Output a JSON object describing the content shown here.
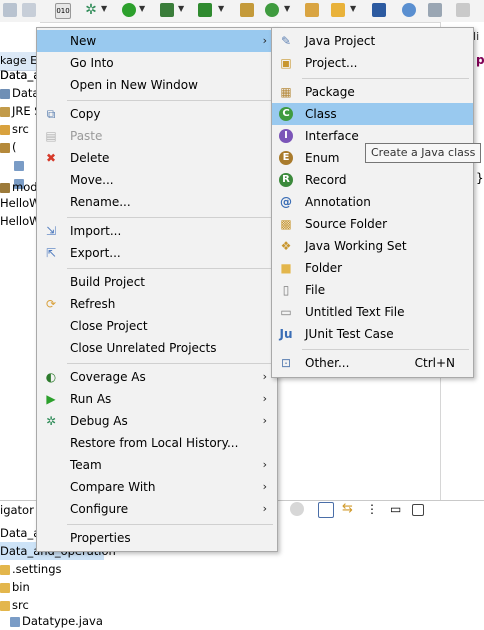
{
  "explorer": {
    "tab_title": "kage E:",
    "rows": [
      "Data_an",
      "Data_an",
      "JRE S",
      "src",
      "(",
      "",
      "",
      "mod",
      "HelloW",
      "HelloW"
    ]
  },
  "main_menu": {
    "items": [
      {
        "label": "New",
        "has_submenu": true,
        "icon": "none"
      },
      {
        "label": "Go Into",
        "has_submenu": false,
        "icon": "none"
      },
      {
        "label": "Open in New Window",
        "has_submenu": false,
        "icon": "none"
      },
      {
        "label": "Copy",
        "has_submenu": false,
        "icon": "copy-icon"
      },
      {
        "label": "Paste",
        "has_submenu": false,
        "icon": "paste-icon",
        "disabled": true
      },
      {
        "label": "Delete",
        "has_submenu": false,
        "icon": "delete-icon"
      },
      {
        "label": "Move...",
        "has_submenu": false,
        "icon": "none"
      },
      {
        "label": "Rename...",
        "has_submenu": false,
        "icon": "none"
      },
      {
        "label": "Import...",
        "has_submenu": false,
        "icon": "import-icon"
      },
      {
        "label": "Export...",
        "has_submenu": false,
        "icon": "export-icon"
      },
      {
        "label": "Build Project",
        "has_submenu": false,
        "icon": "none"
      },
      {
        "label": "Refresh",
        "has_submenu": false,
        "icon": "refresh-icon"
      },
      {
        "label": "Close Project",
        "has_submenu": false,
        "icon": "none"
      },
      {
        "label": "Close Unrelated Projects",
        "has_submenu": false,
        "icon": "none"
      },
      {
        "label": "Coverage As",
        "has_submenu": true,
        "icon": "coverage-icon"
      },
      {
        "label": "Run As",
        "has_submenu": true,
        "icon": "run-icon"
      },
      {
        "label": "Debug As",
        "has_submenu": true,
        "icon": "debug-icon"
      },
      {
        "label": "Restore from Local History...",
        "has_submenu": false,
        "icon": "none"
      },
      {
        "label": "Team",
        "has_submenu": true,
        "icon": "none"
      },
      {
        "label": "Compare With",
        "has_submenu": true,
        "icon": "none"
      },
      {
        "label": "Configure",
        "has_submenu": true,
        "icon": "none"
      },
      {
        "label": "Properties",
        "has_submenu": false,
        "icon": "none"
      }
    ]
  },
  "sub_menu": {
    "items": [
      {
        "label": "Java Project",
        "icon": "java-project-icon"
      },
      {
        "label": "Project...",
        "icon": "project-icon"
      },
      {
        "label": "Package",
        "icon": "package-icon"
      },
      {
        "label": "Class",
        "icon": "class-icon",
        "highlighted": true
      },
      {
        "label": "Interface",
        "icon": "interface-icon"
      },
      {
        "label": "Enum",
        "icon": "enum-icon"
      },
      {
        "label": "Record",
        "icon": "record-icon"
      },
      {
        "label": "Annotation",
        "icon": "annotation-icon"
      },
      {
        "label": "Source Folder",
        "icon": "source-folder-icon"
      },
      {
        "label": "Java Working Set",
        "icon": "working-set-icon"
      },
      {
        "label": "Folder",
        "icon": "folder-icon"
      },
      {
        "label": "File",
        "icon": "file-icon"
      },
      {
        "label": "Untitled Text File",
        "icon": "text-file-icon"
      },
      {
        "label": "JUnit Test Case",
        "icon": "junit-icon"
      },
      {
        "label": "Other...",
        "icon": "other-icon",
        "accelerator": "Ctrl+N"
      }
    ]
  },
  "tooltip": {
    "text": "Create a Java class"
  },
  "navigator": {
    "tab_title": "igator",
    "rows": [
      "Data_ar",
      "Data_and_operation",
      ".settings",
      "bin",
      "src",
      "Datatype.java"
    ]
  },
  "editor": {
    "tab_fragment": "lli",
    "code_fragment": "p",
    "brace": "}"
  },
  "colors": {
    "menu_bg": "#f2f2f2",
    "highlight": "#99c9ef",
    "selection": "#cde3f7"
  }
}
